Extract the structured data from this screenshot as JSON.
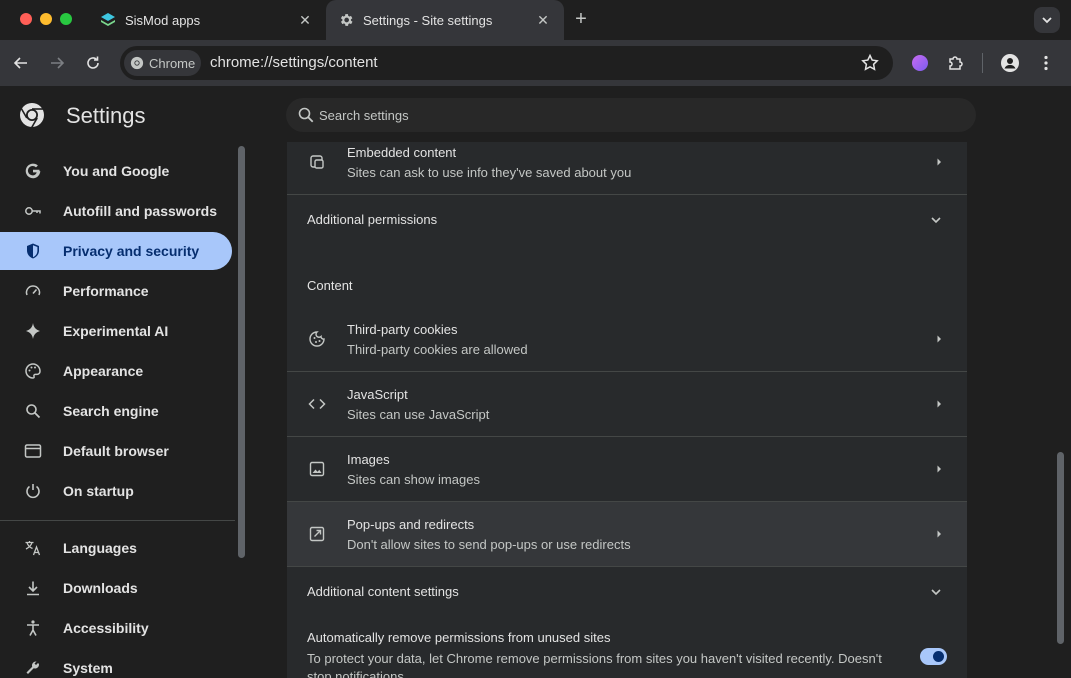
{
  "tabs": [
    {
      "title": "SisMod apps",
      "active": false
    },
    {
      "title": "Settings - Site settings",
      "active": true
    }
  ],
  "toolbar": {
    "chip_label": "Chrome",
    "url": "chrome://settings/content"
  },
  "header": {
    "title": "Settings",
    "search_placeholder": "Search settings"
  },
  "sidebar": {
    "items": [
      {
        "label": "You and Google",
        "icon": "google-g-icon",
        "active": false
      },
      {
        "label": "Autofill and passwords",
        "icon": "key-icon",
        "active": false
      },
      {
        "label": "Privacy and security",
        "icon": "shield-icon",
        "active": true
      },
      {
        "label": "Performance",
        "icon": "speedometer-icon",
        "active": false
      },
      {
        "label": "Experimental AI",
        "icon": "sparkle-icon",
        "active": false
      },
      {
        "label": "Appearance",
        "icon": "palette-icon",
        "active": false
      },
      {
        "label": "Search engine",
        "icon": "magnifier-icon",
        "active": false
      },
      {
        "label": "Default browser",
        "icon": "browser-window-icon",
        "active": false
      },
      {
        "label": "On startup",
        "icon": "power-icon",
        "active": false
      },
      {
        "label": "Languages",
        "icon": "translate-icon",
        "active": false
      },
      {
        "label": "Downloads",
        "icon": "download-icon",
        "active": false
      },
      {
        "label": "Accessibility",
        "icon": "accessibility-icon",
        "active": false
      },
      {
        "label": "System",
        "icon": "wrench-icon",
        "active": false
      }
    ]
  },
  "main": {
    "embedded": {
      "title": "Embedded content",
      "subtitle": "Sites can ask to use info they've saved about you"
    },
    "additional_permissions": "Additional permissions",
    "content_heading": "Content",
    "content_rows": [
      {
        "title": "Third-party cookies",
        "subtitle": "Third-party cookies are allowed",
        "icon": "cookie-icon"
      },
      {
        "title": "JavaScript",
        "subtitle": "Sites can use JavaScript",
        "icon": "code-icon"
      },
      {
        "title": "Images",
        "subtitle": "Sites can show images",
        "icon": "image-icon"
      },
      {
        "title": "Pop-ups and redirects",
        "subtitle": "Don't allow sites to send pop-ups or use redirects",
        "icon": "open-external-icon"
      }
    ],
    "additional_content": "Additional content settings",
    "auto_remove": {
      "title": "Automatically remove permissions from unused sites",
      "description": "To protect your data, let Chrome remove permissions from sites you haven't visited recently. Doesn't stop notifications",
      "enabled": true
    }
  },
  "colors": {
    "accent": "#a8c7fa",
    "background": "#1f1f1f",
    "card": "#282a2c",
    "toolbar": "#35363a"
  }
}
